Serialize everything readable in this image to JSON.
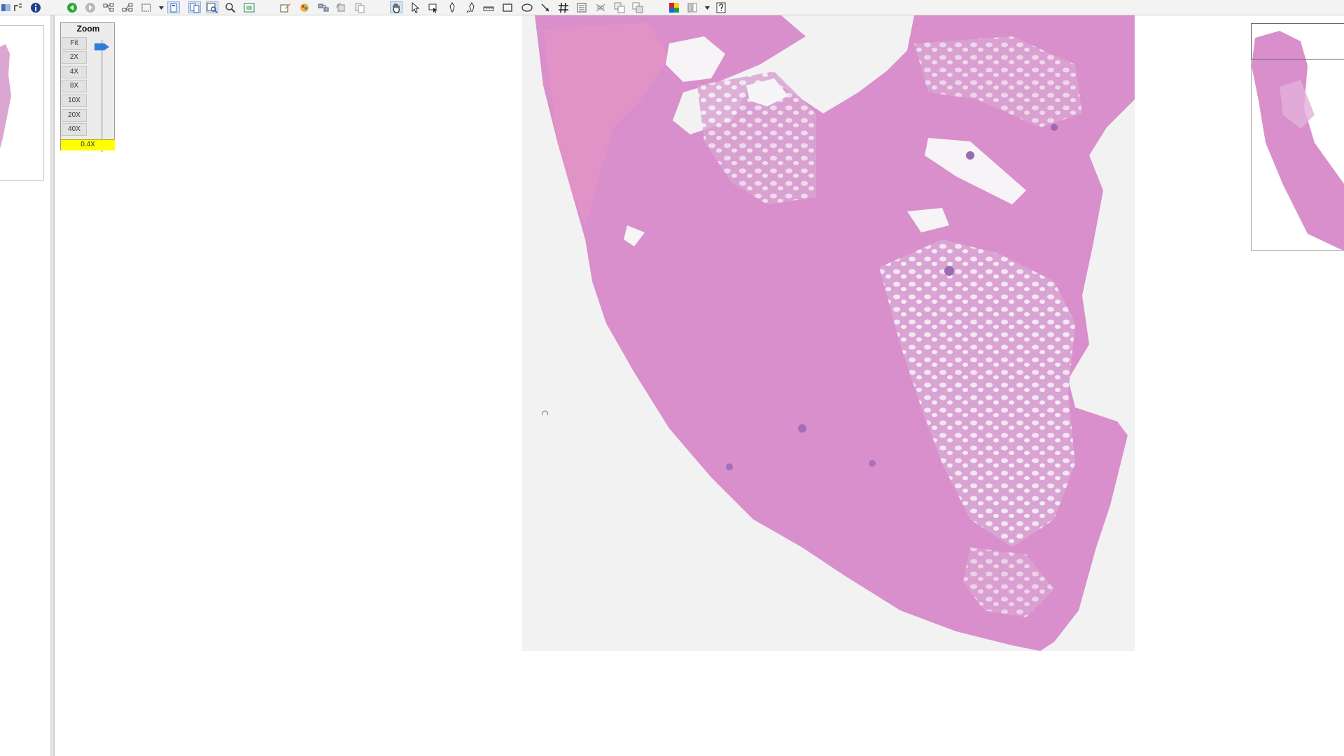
{
  "toolbar": {
    "buttons": [
      "split-view-icon",
      "annotation-info-icon",
      "info-icon",
      "back-arrow-icon",
      "forward-arrow-icon",
      "tree-layout-icon",
      "tree-layout-alt-icon",
      "region-select-icon",
      "view-single-icon",
      "view-dual-icon",
      "image-search-icon",
      "magnifier-icon",
      "overview-icon",
      "edit-note-icon",
      "color-wheel-icon",
      "sync-icon",
      "rotate-icon",
      "copy-icon",
      "pan-hand-icon",
      "pointer-arrow-icon",
      "snapshot-icon",
      "pen-icon",
      "freehand-pen-icon",
      "ruler-icon",
      "rectangle-tool-icon",
      "ellipse-tool-icon",
      "arrow-tool-icon",
      "grid-hash-icon",
      "list-icon",
      "crossed-tool-icon",
      "duplicate-icon",
      "duplicate-alt-icon",
      "color-adjust-icon",
      "filter-icon",
      "help-icon"
    ],
    "pressed": [
      "view-single-icon",
      "view-dual-icon",
      "image-search-icon",
      "pan-hand-icon"
    ]
  },
  "zoom": {
    "title": "Zoom",
    "levels": [
      "Fit",
      "2X",
      "4X",
      "8X",
      "10X",
      "20X",
      "40X"
    ],
    "current": "0.4X",
    "handle_color": "#2f7fd8",
    "current_bg": "#ffff00"
  },
  "viewer": {
    "background": "#ffffff",
    "tissue_fill": "#d89ccd",
    "tile_bg": "#f1f0f1"
  }
}
